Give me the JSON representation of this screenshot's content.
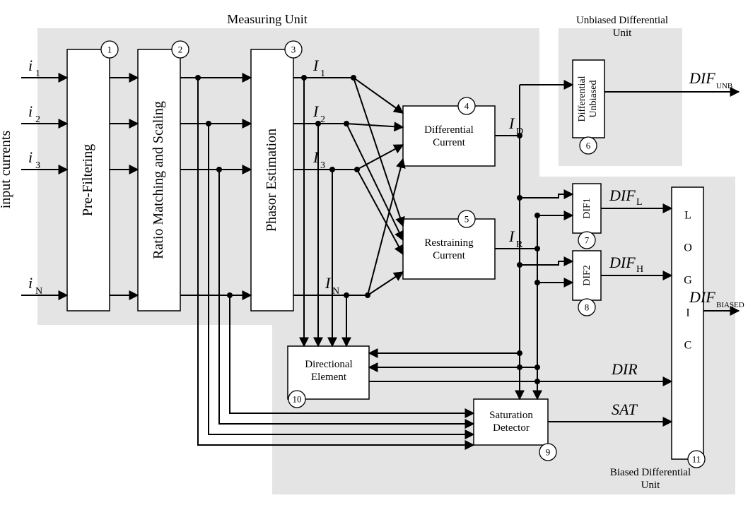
{
  "regions": {
    "measuring": "Measuring Unit",
    "unbiased": "Unbiased Differential Unit",
    "biased": "Biased Differential Unit"
  },
  "sideLabel": "input currents",
  "inputs": {
    "i1": {
      "base": "i",
      "sub": "1"
    },
    "i2": {
      "base": "i",
      "sub": "2"
    },
    "i3": {
      "base": "i",
      "sub": "3"
    },
    "iN": {
      "base": "i",
      "sub": "N"
    }
  },
  "phasorOut": {
    "I1": {
      "base": "I",
      "sub": "1"
    },
    "I2": {
      "base": "I",
      "sub": "2"
    },
    "I3": {
      "base": "I",
      "sub": "3"
    },
    "IN": {
      "base": "I",
      "sub": "N"
    }
  },
  "midSignals": {
    "ID": {
      "base": "I",
      "sub": "D"
    },
    "IR": {
      "base": "I",
      "sub": "R"
    }
  },
  "outputs": {
    "DIFUNB": {
      "base": "DIF",
      "sub": "UNB"
    },
    "DIFL": {
      "base": "DIF",
      "sub": "L"
    },
    "DIFH": {
      "base": "DIF",
      "sub": "H"
    },
    "DIR": {
      "base": "DIR",
      "sub": ""
    },
    "SAT": {
      "base": "SAT",
      "sub": ""
    },
    "DIFBIASED": {
      "base": "DIF",
      "sub": "BIASED"
    }
  },
  "blocks": {
    "prefilter": "Pre-Filtering",
    "ratio": "Ratio Matching and Scaling",
    "phasor": "Phasor Estimation",
    "diffcur_l1": "Differential",
    "diffcur_l2": "Current",
    "restcur_l1": "Restraining",
    "restcur_l2": "Current",
    "diffunb_l1": "Differential",
    "diffunb_l2": "Unbiased",
    "dif1": "DIF1",
    "dif2": "DIF2",
    "logic": "L O G I C",
    "dir_l1": "Directional",
    "dir_l2": "Element",
    "sat_l1": "Saturation",
    "sat_l2": "Detector"
  },
  "badges": {
    "b1": "1",
    "b2": "2",
    "b3": "3",
    "b4": "4",
    "b5": "5",
    "b6": "6",
    "b7": "7",
    "b8": "8",
    "b9": "9",
    "b10": "10",
    "b11": "11"
  }
}
